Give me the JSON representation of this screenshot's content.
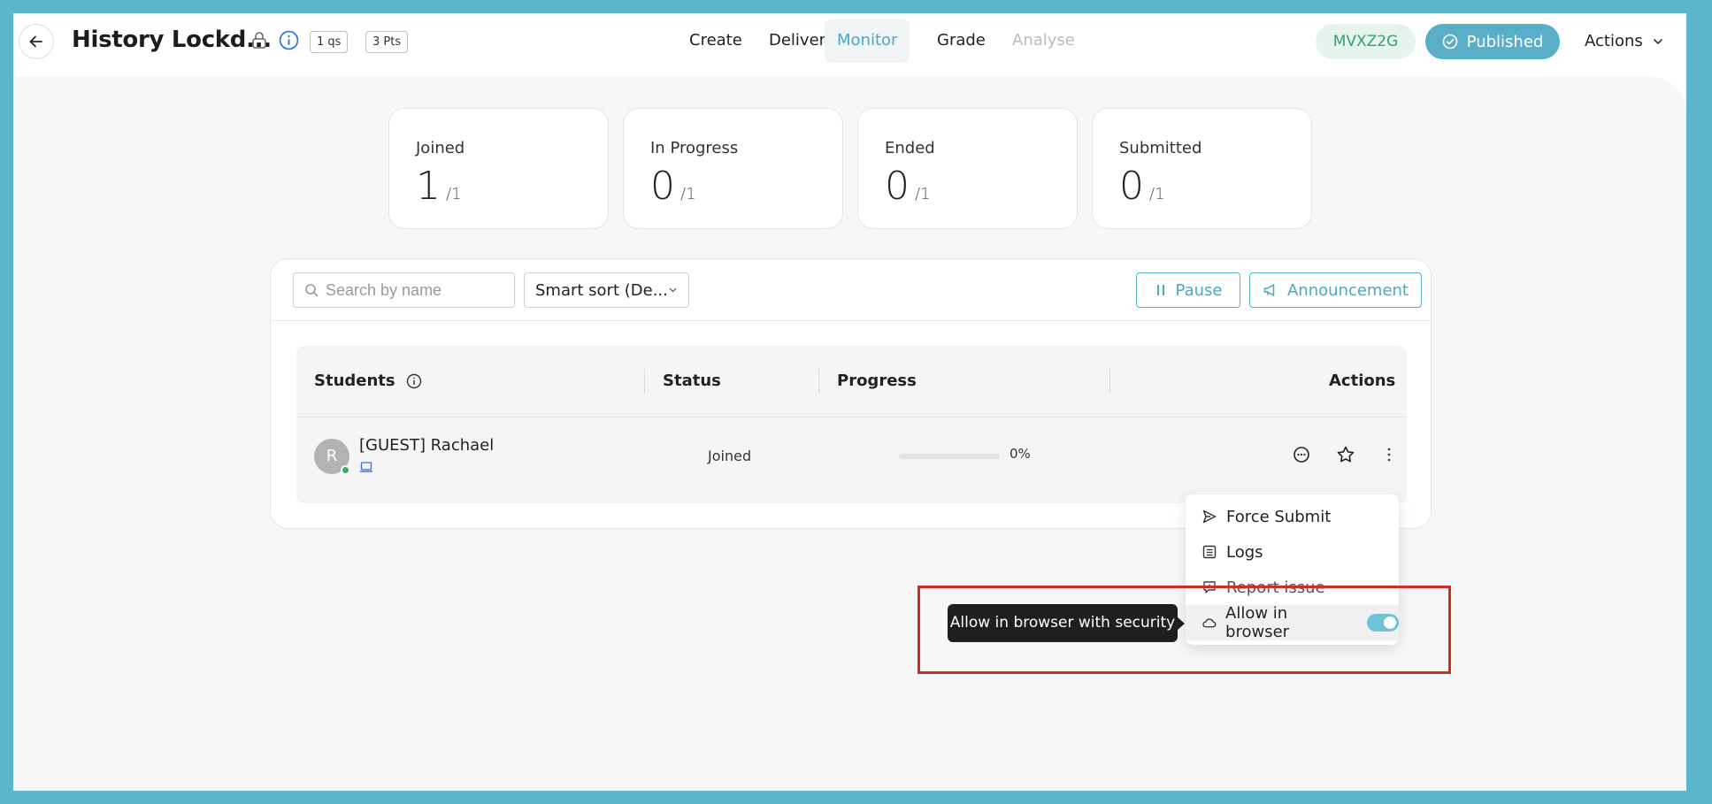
{
  "header": {
    "title": "History Lockd...",
    "questions_chip": "1 qs",
    "points_chip": "3 Pts",
    "nav": [
      {
        "label": "Create",
        "state": "normal"
      },
      {
        "label": "Deliver",
        "state": "normal"
      },
      {
        "label": "Monitor",
        "state": "active"
      },
      {
        "label": "Grade",
        "state": "normal"
      },
      {
        "label": "Analyse",
        "state": "disabled"
      }
    ],
    "join_code": "MVXZ2G",
    "publish_label": "Published",
    "actions_label": "Actions"
  },
  "stats": [
    {
      "label": "Joined",
      "value": "1",
      "total": "/1"
    },
    {
      "label": "In Progress",
      "value": "0",
      "total": "/1"
    },
    {
      "label": "Ended",
      "value": "0",
      "total": "/1"
    },
    {
      "label": "Submitted",
      "value": "0",
      "total": "/1"
    }
  ],
  "toolbar": {
    "search_placeholder": "Search by name",
    "sort_label": "Smart sort (De...",
    "pause_label": "Pause",
    "announcement_label": "Announcement"
  },
  "table": {
    "headers": {
      "students": "Students",
      "status": "Status",
      "progress": "Progress",
      "actions": "Actions"
    },
    "rows": [
      {
        "avatar_initial": "R",
        "name": "[GUEST] Rachael",
        "status": "Joined",
        "progress_label": "0%",
        "progress_value": 0,
        "online": true
      }
    ]
  },
  "context_menu": {
    "items": [
      {
        "label": "Force Submit",
        "icon": "send-icon"
      },
      {
        "label": "Logs",
        "icon": "list-icon"
      },
      {
        "label": "Report issue",
        "icon": "report-icon"
      },
      {
        "label": "Allow in browser",
        "icon": "cloud-icon",
        "toggle": true
      }
    ]
  },
  "tooltip": {
    "text": "Allow in browser with security"
  },
  "colors": {
    "frame": "#5bb5cd",
    "accent": "#5aaec8",
    "code_bg": "#e6f4ee",
    "code_text": "#3b9b73",
    "highlight": "#cc2e22"
  }
}
